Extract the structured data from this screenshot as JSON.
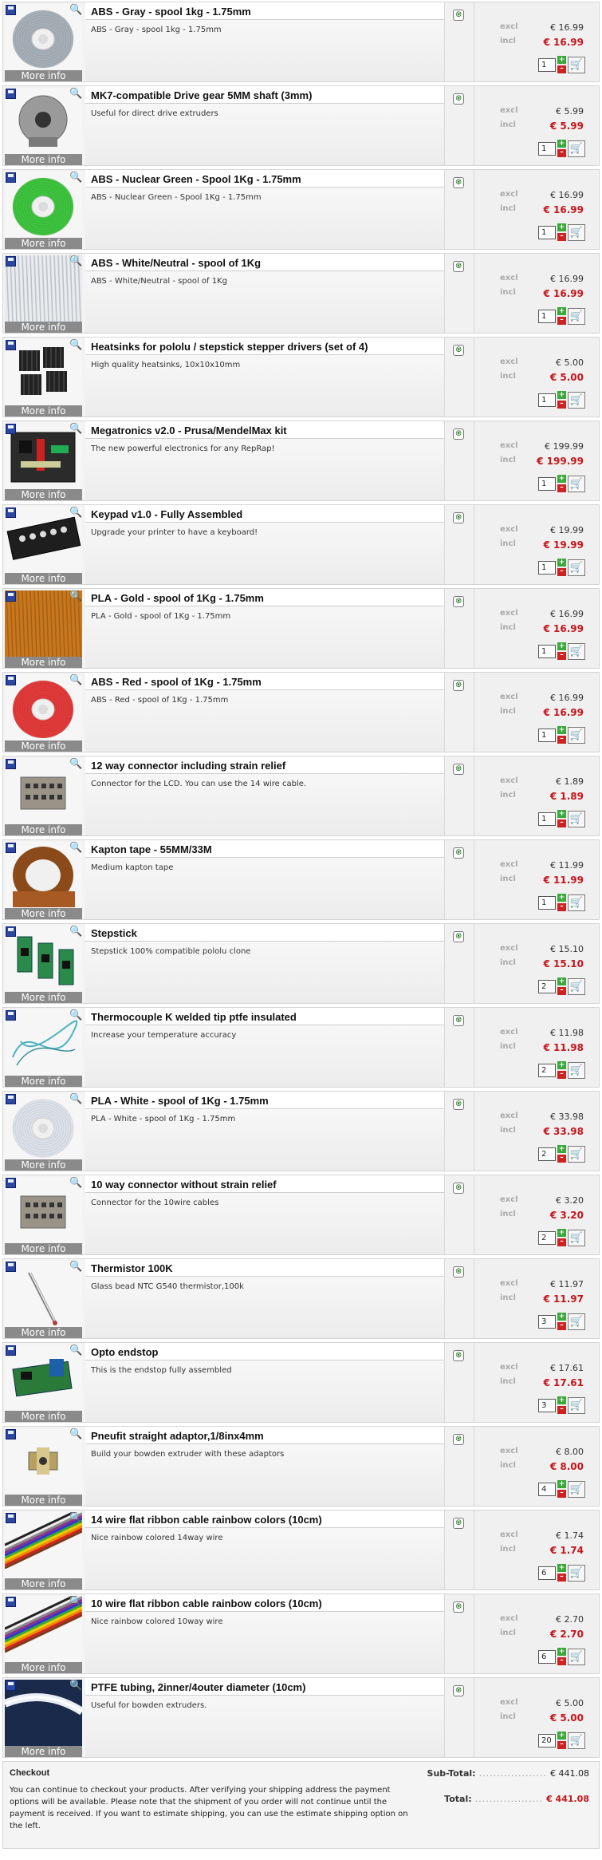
{
  "labels": {
    "more_info": "More info",
    "excl": "excl",
    "incl": "incl"
  },
  "items": [
    {
      "title": "ABS - Gray - spool 1kg - 1.75mm",
      "desc": "ABS - Gray - spool 1kg - 1.75mm",
      "excl": "€ 16.99",
      "incl": "€ 16.99",
      "qty": "1",
      "thumb": "spool",
      "color": "#a7b0b8"
    },
    {
      "title": "MK7-compatible Drive gear 5MM shaft (3mm)",
      "desc": "Useful for direct drive extruders",
      "excl": "€ 5.99",
      "incl": "€ 5.99",
      "qty": "1",
      "thumb": "gear",
      "color": "#888888"
    },
    {
      "title": "ABS - Nuclear Green - Spool 1Kg - 1.75mm",
      "desc": "ABS - Nuclear Green - Spool 1Kg - 1.75mm",
      "excl": "€ 16.99",
      "incl": "€ 16.99",
      "qty": "1",
      "thumb": "spool",
      "color": "#3ec43e"
    },
    {
      "title": "ABS - White/Neutral - spool of 1Kg",
      "desc": "ABS - White/Neutral - spool of 1Kg",
      "excl": "€ 16.99",
      "incl": "€ 16.99",
      "qty": "1",
      "thumb": "filament-lines",
      "color": "#e8ecf0"
    },
    {
      "title": "Heatsinks for pololu / stepstick stepper drivers (set of 4)",
      "desc": "High quality heatsinks, 10x10x10mm",
      "excl": "€ 5.00",
      "incl": "€ 5.00",
      "qty": "1",
      "thumb": "heatsinks",
      "color": "#222222"
    },
    {
      "title": "Megatronics v2.0 - Prusa/MendelMax kit",
      "desc": "The new powerful electronics for any RepRap!",
      "excl": "€ 199.99",
      "incl": "€ 199.99",
      "qty": "1",
      "thumb": "board",
      "color": "#2b2b2b"
    },
    {
      "title": "Keypad v1.0 - Fully Assembled",
      "desc": "Upgrade your printer to have a keyboard!",
      "excl": "€ 19.99",
      "incl": "€ 19.99",
      "qty": "1",
      "thumb": "keypad",
      "color": "#1e1e1e"
    },
    {
      "title": "PLA - Gold - spool of 1Kg - 1.75mm",
      "desc": "PLA - Gold - spool of 1Kg - 1.75mm",
      "excl": "€ 16.99",
      "incl": "€ 16.99",
      "qty": "1",
      "thumb": "filament-lines",
      "color": "#c8771c"
    },
    {
      "title": "ABS - Red - spool of 1Kg - 1.75mm",
      "desc": "ABS - Red - spool of 1Kg - 1.75mm",
      "excl": "€ 16.99",
      "incl": "€ 16.99",
      "qty": "1",
      "thumb": "spool",
      "color": "#e23a3a"
    },
    {
      "title": "12 way connector including strain relief",
      "desc": "Connector for the LCD. You can use the 14 wire cable.",
      "excl": "€ 1.89",
      "incl": "€ 1.89",
      "qty": "1",
      "thumb": "connector",
      "color": "#9a9488"
    },
    {
      "title": "Kapton tape - 55MM/33M",
      "desc": "Medium kapton tape",
      "excl": "€ 11.99",
      "incl": "€ 11.99",
      "qty": "1",
      "thumb": "tape",
      "color": "#8a4a1a"
    },
    {
      "title": "Stepstick",
      "desc": "Stepstick 100% compatible pololu clone",
      "excl": "€ 15.10",
      "incl": "€ 15.10",
      "qty": "2",
      "thumb": "stepstick",
      "color": "#2a8a4a"
    },
    {
      "title": "Thermocouple K welded tip ptfe insulated",
      "desc": "Increase your temperature accuracy",
      "excl": "€ 11.98",
      "incl": "€ 11.98",
      "qty": "2",
      "thumb": "wire",
      "color": "#4fb3c0"
    },
    {
      "title": "PLA - White - spool of 1Kg - 1.75mm",
      "desc": "PLA - White - spool of 1Kg - 1.75mm",
      "excl": "€ 33.98",
      "incl": "€ 33.98",
      "qty": "2",
      "thumb": "spool",
      "color": "#dde2ea"
    },
    {
      "title": "10 way connector without strain relief",
      "desc": "Connector for the 10wire cables",
      "excl": "€ 3.20",
      "incl": "€ 3.20",
      "qty": "2",
      "thumb": "connector",
      "color": "#9a9488"
    },
    {
      "title": "Thermistor 100K",
      "desc": "Glass bead NTC G540 thermistor,100k",
      "excl": "€ 11.97",
      "incl": "€ 11.97",
      "qty": "3",
      "thumb": "thermistor",
      "color": "#b04040"
    },
    {
      "title": "Opto endstop",
      "desc": "This is the endstop fully assembled",
      "excl": "€ 17.61",
      "incl": "€ 17.61",
      "qty": "3",
      "thumb": "endstop",
      "color": "#2a7a3a"
    },
    {
      "title": "Pneufit straight adaptor,1/8inx4mm",
      "desc": "Build your bowden extruder with these adaptors",
      "excl": "€ 8.00",
      "incl": "€ 8.00",
      "qty": "4",
      "thumb": "fitting",
      "color": "#b8a060"
    },
    {
      "title": "14 wire flat ribbon cable rainbow colors (10cm)",
      "desc": "Nice rainbow colored 14way wire",
      "excl": "€ 1.74",
      "incl": "€ 1.74",
      "qty": "6",
      "thumb": "ribbon",
      "color": "#888888"
    },
    {
      "title": "10 wire flat ribbon cable rainbow colors (10cm)",
      "desc": "Nice rainbow colored 10way wire",
      "excl": "€ 2.70",
      "incl": "€ 2.70",
      "qty": "6",
      "thumb": "ribbon",
      "color": "#888888"
    },
    {
      "title": "PTFE tubing, 2inner/4outer diameter (10cm)",
      "desc": "Useful for bowden extruders.",
      "excl": "€ 5.00",
      "incl": "€ 5.00",
      "qty": "20",
      "thumb": "tube",
      "color": "#1a2a4a"
    }
  ],
  "checkout": {
    "title": "Checkout",
    "text": "You can continue to checkout your products. After verifying your shipping address the payment options will be available. Please note that the shipment of you order will not continue until the payment is received. If you want to estimate shipping, you can use the estimate shipping option on the left.",
    "subtotal_label": "Sub-Total:",
    "subtotal_value": "€ 441.08",
    "total_label": "Total:",
    "total_value": "€ 441.08",
    "dots": "..................."
  }
}
